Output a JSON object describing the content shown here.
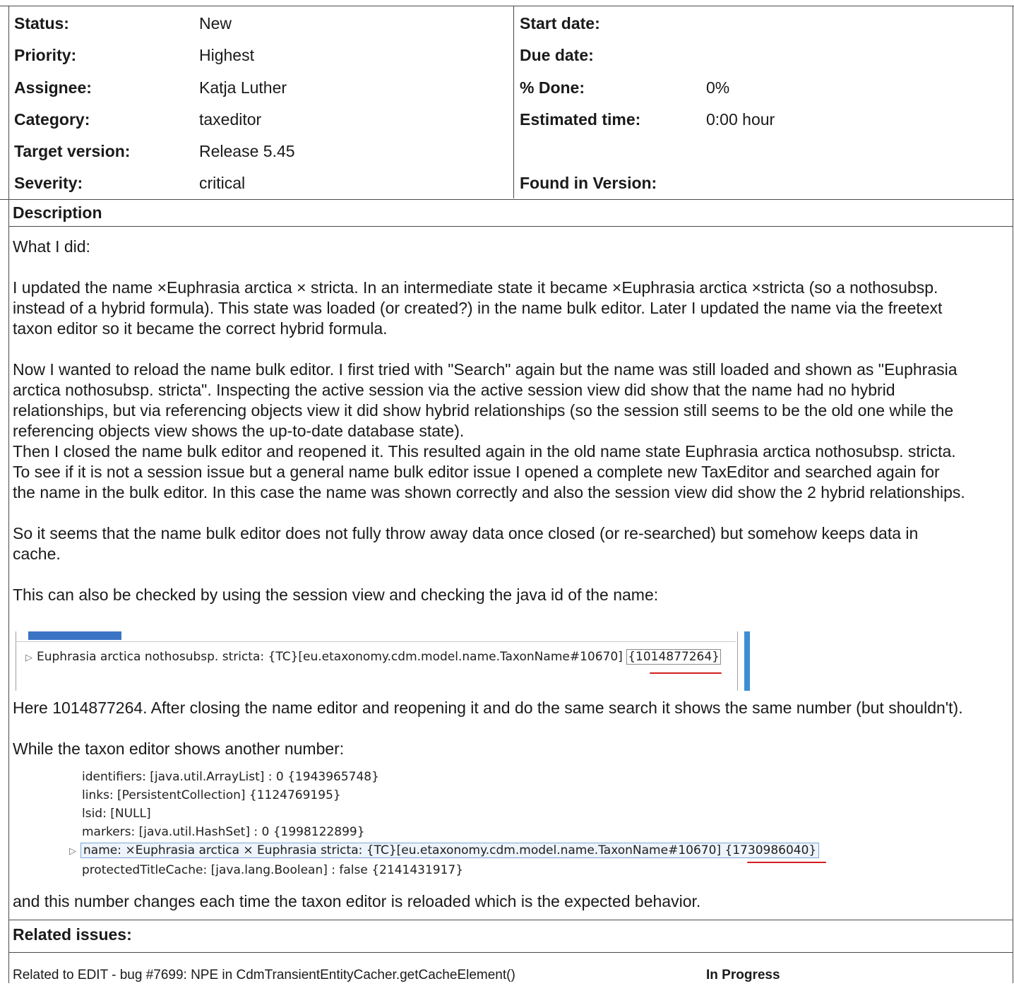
{
  "attributes": {
    "left": [
      {
        "label": "Status:",
        "value": "New"
      },
      {
        "label": "Priority:",
        "value": "Highest"
      },
      {
        "label": "Assignee:",
        "value": "Katja Luther"
      },
      {
        "label": "Category:",
        "value": "taxeditor"
      },
      {
        "label": "Target version:",
        "value": "Release 5.45"
      },
      {
        "label": "Severity:",
        "value": "critical"
      }
    ],
    "right": [
      {
        "label": "Start date:",
        "value": ""
      },
      {
        "label": "Due date:",
        "value": ""
      },
      {
        "label": "% Done:",
        "value": "0%"
      },
      {
        "label": "Estimated time:",
        "value": "0:00 hour"
      },
      {
        "label": "",
        "value": ""
      },
      {
        "label": "Found in Version:",
        "value": ""
      }
    ]
  },
  "description": {
    "heading": "Description",
    "p1": "What I did:",
    "p2": [
      "I updated the name ×Euphrasia arctica × stricta. In an intermediate state it became ×Euphrasia arctica ×stricta (so a nothosubsp.",
      "instead of a hybrid formula). This state was loaded (or created?) in the name bulk editor. Later I updated the name via the freetext",
      "taxon editor so it became the correct hybrid formula."
    ],
    "p3": [
      "Now I wanted to reload the name bulk editor. I first tried with \"Search\" again but the name was still loaded and shown as \"Euphrasia",
      "arctica nothosubsp. stricta\". Inspecting the active session via the active session view did show that the name had no hybrid",
      "relationships, but via referencing objects view it did show hybrid relationships (so the session still seems to be the old one while the",
      "referencing objects view shows the up-to-date database state).",
      "Then I closed the name bulk editor and reopened it. This resulted again in the old name state Euphrasia arctica nothosubsp. stricta.",
      "To see if it is not a session issue but a general name bulk editor issue I opened a complete new TaxEditor and searched again for",
      "the name in the bulk editor. In this case the name was shown correctly and also the session view did show the 2 hybrid relationships."
    ],
    "p4": [
      "So it seems that the name bulk editor does not fully throw away data once closed (or re-searched) but somehow keeps data in",
      "cache."
    ],
    "p5": "This can also be checked by using the session view and checking the java id of the name:",
    "shot1": {
      "text": "Euphrasia arctica nothosubsp. stricta: {TC}[eu.etaxonomy.cdm.model.name.TaxonName#10670] ",
      "id": "{1014877264}"
    },
    "p6": "Here 1014877264. After closing the name editor and reopening it and do the same search it shows the same number (but shouldn't).",
    "p7": "While the taxon editor shows another number:",
    "shot2": {
      "lines": [
        "identifiers: [java.util.ArrayList] : 0 {1943965748}",
        "links: [PersistentCollection] {1124769195}",
        "lsid: [NULL]",
        "markers: [java.util.HashSet] : 0 {1998122899}"
      ],
      "selected": "name: ×Euphrasia arctica × Euphrasia stricta: {TC}[eu.etaxonomy.cdm.model.name.TaxonName#10670] {1730986040}",
      "last": "protectedTitleCache: [java.lang.Boolean] : false {2141431917}"
    },
    "p8": "and this number changes each time the taxon editor is reloaded which is the expected behavior."
  },
  "related": {
    "heading": "Related issues:",
    "item": "Related to EDIT - bug #7699: NPE in CdmTransientEntityCacher.getCacheElement()",
    "status": "In Progress"
  }
}
